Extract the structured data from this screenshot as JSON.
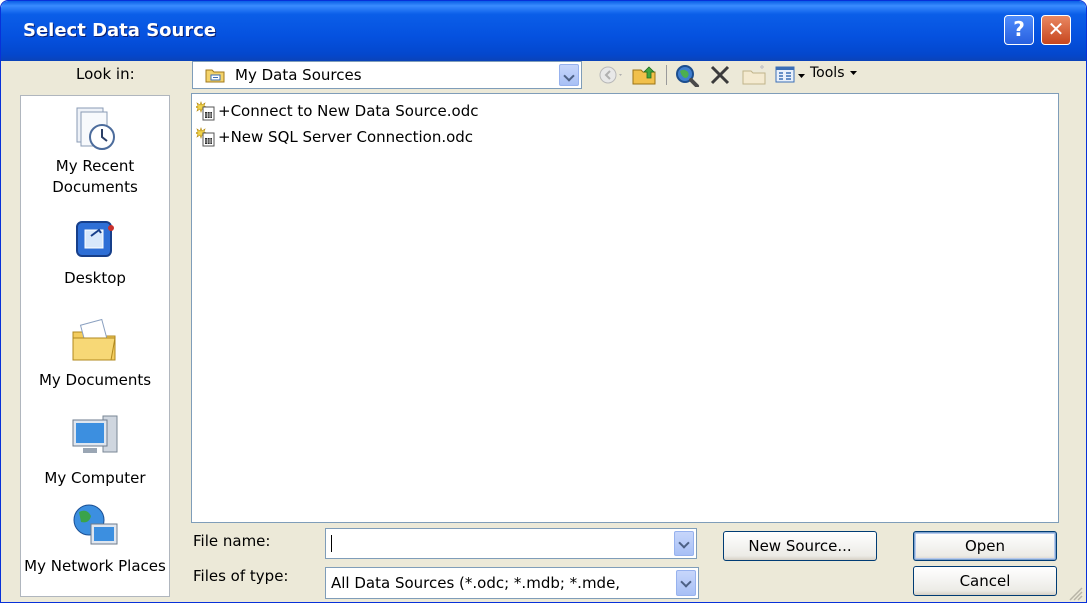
{
  "window": {
    "title": "Select Data Source",
    "help_label": "?",
    "close_label": "✕"
  },
  "look_in": {
    "label": "Look in:",
    "value": "My Data Sources"
  },
  "toolbar": {
    "back_icon": "back-icon",
    "up_icon": "up-folder-icon",
    "search_icon": "search-web-icon",
    "delete_icon": "delete-icon",
    "new_folder_icon": "new-folder-icon",
    "views_icon": "views-icon",
    "tools_label": "Tools"
  },
  "places": [
    {
      "label": "My Recent Documents",
      "icon": "recent-documents-icon"
    },
    {
      "label": "Desktop",
      "icon": "desktop-icon"
    },
    {
      "label": "My Documents",
      "icon": "my-documents-icon"
    },
    {
      "label": "My Computer",
      "icon": "my-computer-icon"
    },
    {
      "label": "My Network Places",
      "icon": "network-places-icon"
    }
  ],
  "files": [
    {
      "name": "+Connect to New Data Source.odc",
      "selected": true
    },
    {
      "name": "+New SQL Server Connection.odc",
      "selected": false
    }
  ],
  "file_name": {
    "label": "File name:",
    "value": ""
  },
  "file_type": {
    "label": "Files of type:",
    "value": "All Data Sources (*.odc; *.mdb; *.mde,"
  },
  "buttons": {
    "new_source": "New Source...",
    "open": "Open",
    "cancel": "Cancel"
  },
  "colors": {
    "titlebar": "#0551df",
    "dialog_bg": "#ece9d8",
    "close_button": "#c7461e"
  }
}
